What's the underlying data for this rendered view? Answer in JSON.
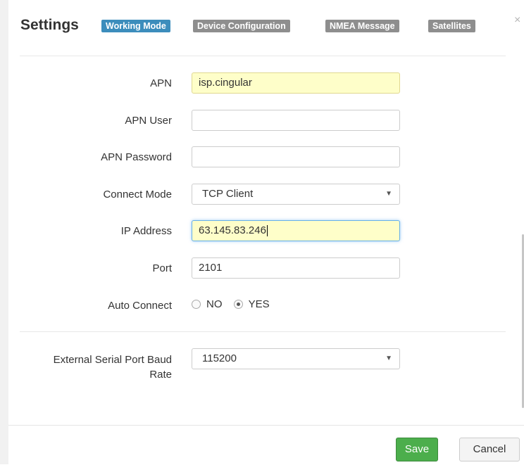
{
  "header": {
    "title": "Settings",
    "tabs": [
      {
        "label": "Working Mode",
        "active": true
      },
      {
        "label": "Device Configuration",
        "active": false
      },
      {
        "label": "NMEA Message",
        "active": false
      },
      {
        "label": "Satellites",
        "active": false
      }
    ],
    "close_glyph": "×"
  },
  "form": {
    "apn": {
      "label": "APN",
      "value": "isp.cingular"
    },
    "apn_user": {
      "label": "APN User",
      "value": ""
    },
    "apn_password": {
      "label": "APN Password",
      "value": ""
    },
    "connect_mode": {
      "label": "Connect Mode",
      "value": "TCP Client"
    },
    "ip_address": {
      "label": "IP Address",
      "value": "63.145.83.246"
    },
    "port": {
      "label": "Port",
      "value": "2101"
    },
    "auto_connect": {
      "label": "Auto Connect",
      "options": [
        "NO",
        "YES"
      ],
      "selected": "YES"
    },
    "baud_rate": {
      "label_line1": "External Serial Port Baud",
      "label_line2": "Rate",
      "value": "115200"
    }
  },
  "footer": {
    "save_label": "Save",
    "cancel_label": "Cancel"
  },
  "colors": {
    "active_tab": "#3c8dbc",
    "inactive_tab": "#8e8e8e",
    "save_button": "#4cae4c",
    "autofill_background": "#fefec9"
  },
  "icons": {
    "dropdown": "chevron-down-icon",
    "close": "close-icon"
  }
}
